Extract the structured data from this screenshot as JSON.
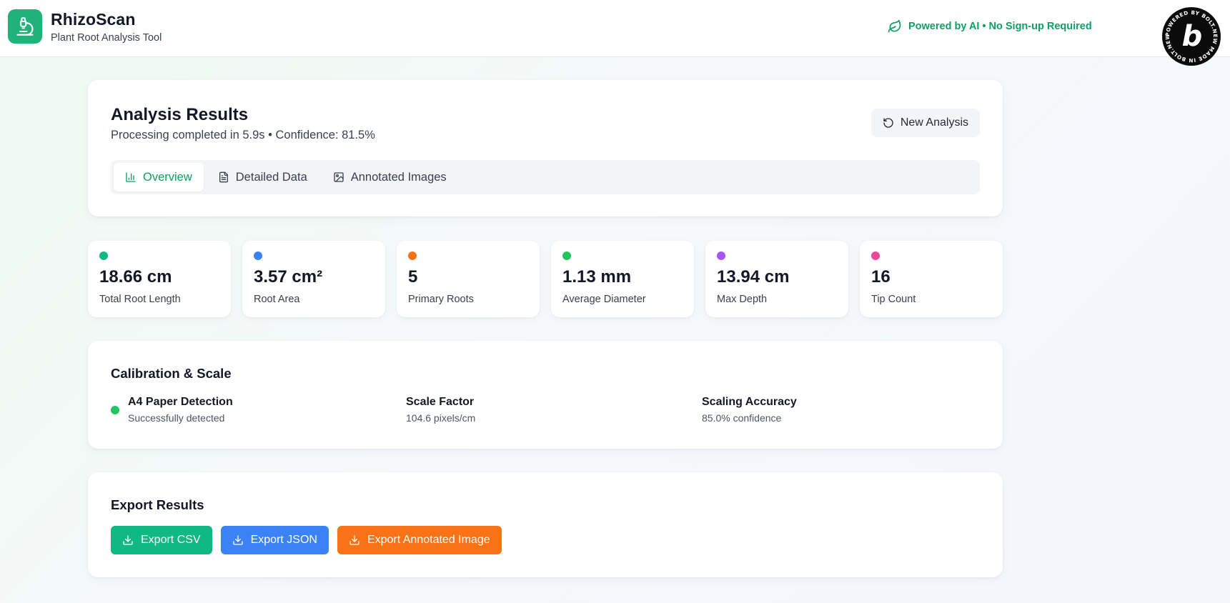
{
  "header": {
    "title": "RhizoScan",
    "subtitle": "Plant Root Analysis Tool",
    "badge": "Powered by AI • No Sign-up Required",
    "bolt_badge_text": "POWERED BY BOLT.NEW MADE IN BOLT.NEW"
  },
  "results": {
    "title": "Analysis Results",
    "subtitle": "Processing completed in 5.9s • Confidence: 81.5%",
    "new_analysis_label": "New Analysis",
    "tabs": [
      {
        "label": "Overview",
        "active": true
      },
      {
        "label": "Detailed Data",
        "active": false
      },
      {
        "label": "Annotated Images",
        "active": false
      }
    ]
  },
  "metrics": [
    {
      "value": "18.66 cm",
      "label": "Total Root Length",
      "color": "#10b981"
    },
    {
      "value": "3.57 cm²",
      "label": "Root Area",
      "color": "#3b82f6"
    },
    {
      "value": "5",
      "label": "Primary Roots",
      "color": "#f97316"
    },
    {
      "value": "1.13 mm",
      "label": "Average Diameter",
      "color": "#22c55e"
    },
    {
      "value": "13.94 cm",
      "label": "Max Depth",
      "color": "#a855f7"
    },
    {
      "value": "16",
      "label": "Tip Count",
      "color": "#ec4899"
    }
  ],
  "calibration": {
    "title": "Calibration & Scale",
    "items": [
      {
        "title": "A4 Paper Detection",
        "sub": "Successfully detected"
      },
      {
        "title": "Scale Factor",
        "sub": "104.6 pixels/cm"
      },
      {
        "title": "Scaling Accuracy",
        "sub": "85.0% confidence"
      }
    ]
  },
  "export": {
    "title": "Export Results",
    "buttons": [
      {
        "label": "Export CSV",
        "color": "#10b981"
      },
      {
        "label": "Export JSON",
        "color": "#3b82f6"
      },
      {
        "label": "Export Annotated Image",
        "color": "#f97316"
      }
    ]
  },
  "colors": {
    "brand": "#1fb37a",
    "accent_text": "#0e9f61"
  }
}
